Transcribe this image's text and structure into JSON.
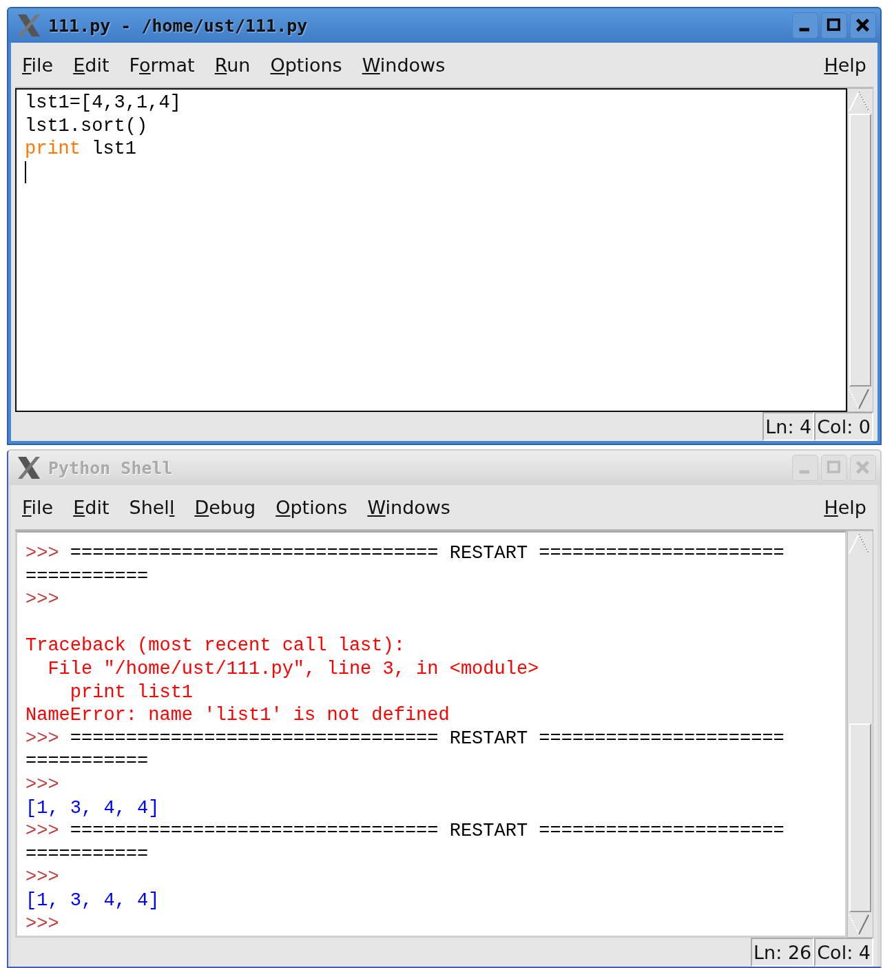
{
  "windows": [
    {
      "title": "111.py - /home/ust/111.py",
      "active": true,
      "kind": "editor",
      "menus": [
        {
          "key": "F",
          "rest": "ile"
        },
        {
          "key": "E",
          "rest": "dit"
        },
        {
          "lead": "F",
          "key": "o",
          "rest": "rmat"
        },
        {
          "key": "R",
          "rest": "un"
        },
        {
          "key": "O",
          "rest": "ptions"
        },
        {
          "key": "W",
          "rest": "indows"
        }
      ],
      "help_menu": {
        "key": "H",
        "rest": "elp"
      },
      "lines": [
        [
          {
            "kind": "code",
            "text": "lst1=[4,3,1,4]"
          }
        ],
        [
          {
            "kind": "code",
            "text": "lst1.sort()"
          }
        ],
        [
          {
            "kind": "keyword",
            "text": "print"
          },
          {
            "kind": "code",
            "text": " lst1"
          }
        ]
      ],
      "cursor": true,
      "status": {
        "line": "Ln: 4",
        "column": "Col: 0"
      }
    },
    {
      "title": "Python Shell",
      "active": false,
      "kind": "shell",
      "menus": [
        {
          "key": "F",
          "rest": "ile"
        },
        {
          "key": "E",
          "rest": "dit"
        },
        {
          "lead": "Shel",
          "key": "l"
        },
        {
          "key": "D",
          "rest": "ebug"
        },
        {
          "key": "O",
          "rest": "ptions"
        },
        {
          "key": "W",
          "rest": "indows"
        }
      ],
      "help_menu": {
        "key": "H",
        "rest": "elp"
      },
      "lines": [
        [
          {
            "kind": "prompt",
            "text": ">>>"
          },
          {
            "kind": "code",
            "text": " ================================= RESTART ================================="
          }
        ],
        [
          {
            "kind": "prompt",
            "text": ">>>"
          }
        ],
        [
          {
            "kind": "blank"
          }
        ],
        [
          {
            "kind": "error",
            "text": "Traceback (most recent call last):"
          }
        ],
        [
          {
            "kind": "error",
            "text": "  File \"/home/ust/111.py\", line 3, in <module>"
          }
        ],
        [
          {
            "kind": "error",
            "text": "    print list1"
          }
        ],
        [
          {
            "kind": "error",
            "text": "NameError: name 'list1' is not defined"
          }
        ],
        [
          {
            "kind": "prompt",
            "text": ">>>"
          },
          {
            "kind": "code",
            "text": " ================================= RESTART ================================="
          }
        ],
        [
          {
            "kind": "prompt",
            "text": ">>>"
          }
        ],
        [
          {
            "kind": "output",
            "text": "[1, 3, 4, 4]"
          }
        ],
        [
          {
            "kind": "prompt",
            "text": ">>>"
          },
          {
            "kind": "code",
            "text": " ================================= RESTART ================================="
          }
        ],
        [
          {
            "kind": "prompt",
            "text": ">>>"
          }
        ],
        [
          {
            "kind": "output",
            "text": "[1, 3, 4, 4]"
          }
        ],
        [
          {
            "kind": "prompt",
            "text": ">>>"
          }
        ]
      ],
      "cursor": false,
      "status": {
        "line": "Ln: 26",
        "column": "Col: 4"
      }
    }
  ]
}
